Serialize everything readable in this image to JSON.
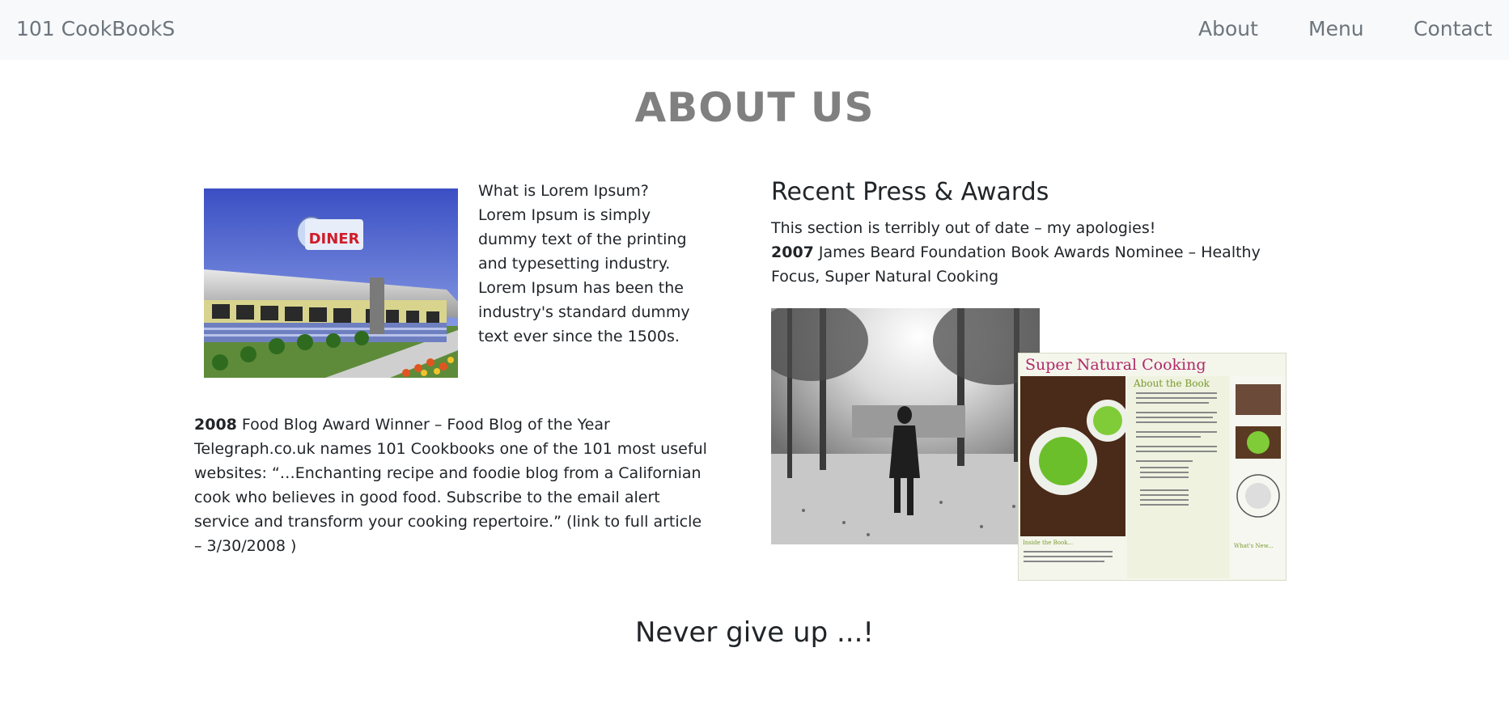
{
  "nav": {
    "brand": "101 CookBookS",
    "links": [
      "About",
      "Menu",
      "Contact"
    ]
  },
  "page": {
    "title": "ABOUT US"
  },
  "intro": {
    "text": "What is Lorem Ipsum? Lorem Ipsum is simply dummy text of the printing and typesetting industry. Lorem Ipsum has been the industry's standard dummy text ever since the 1500s."
  },
  "diner_sign": "DINER",
  "blog_award": {
    "year": "2008",
    "text": " Food Blog Award Winner – Food Blog of the Year Telegraph.co.uk names 101 Cookbooks one of the 101 most useful websites: “…Enchanting recipe and foodie blog from a Californian cook who believes in good food. Subscribe to the email alert service and transform your cooking repertoire.” (link to full article – 3/30/2008 )"
  },
  "press": {
    "title": "Recent Press & Awards",
    "note": "This section is terribly out of date – my apologies!",
    "award_year": "2007",
    "award_text": " James Beard Foundation Book Awards Nominee – Healthy Focus, Super Natural Cooking"
  },
  "book_cover": {
    "title": "Super Natural Cooking",
    "heading": "About the Book",
    "inside": "Inside the Book...",
    "whats_new": "What's New..."
  },
  "closing": {
    "title": "Never give up ...!"
  },
  "colors": {
    "navbar_bg": "#f8f9fa",
    "nav_text": "#6c757d",
    "title_gray": "#808080",
    "book_accent": "#b0296a"
  }
}
